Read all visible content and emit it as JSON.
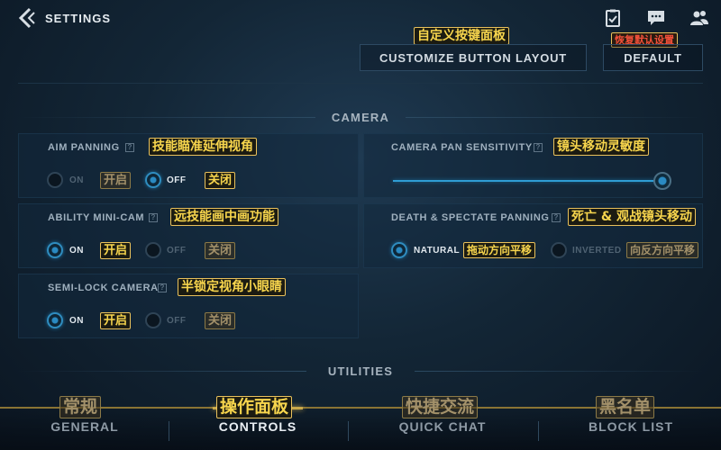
{
  "header": {
    "title": "SETTINGS",
    "icons": [
      "back-chevron-icon",
      "clipboard-check-icon",
      "chat-bubble-icon",
      "friends-icon"
    ]
  },
  "actions": {
    "customize_label": "CUSTOMIZE BUTTON LAYOUT",
    "customize_note": "自定义按键面板",
    "default_label": "DEFAULT",
    "default_note": "恢复默认设置"
  },
  "camera": {
    "section_title": "CAMERA",
    "aim_panning": {
      "label": "AIM PANNING",
      "note": "技能瞄准延伸视角",
      "on_label": "ON",
      "on_note": "开启",
      "off_label": "OFF",
      "off_note": "关闭",
      "selected": "off"
    },
    "ability_minicam": {
      "label": "ABILITY MINI-CAM",
      "note": "远技能画中画功能",
      "on_label": "ON",
      "on_note": "开启",
      "off_label": "OFF",
      "off_note": "关闭",
      "selected": "on"
    },
    "semi_lock": {
      "label": "SEMI-LOCK CAMERA",
      "note": "半锁定视角小眼睛",
      "on_label": "ON",
      "on_note": "开启",
      "off_label": "OFF",
      "off_note": "关闭",
      "selected": "on"
    },
    "pan_sensitivity": {
      "label": "CAMERA PAN SENSITIVITY",
      "note": "镜头移动灵敏度",
      "value_fraction": 1.0
    },
    "death_spectate": {
      "label": "DEATH & SPECTATE PANNING",
      "note": "死亡 & 观战镜头移动",
      "natural_label": "NATURAL",
      "natural_note": "拖动方向平移",
      "inverted_label": "INVERTED",
      "inverted_note": "向反方向平移",
      "selected": "natural"
    }
  },
  "utilities": {
    "section_title": "UTILITIES"
  },
  "tabs": [
    {
      "label": "GENERAL",
      "note": "常规",
      "active": false
    },
    {
      "label": "CONTROLS",
      "note": "操作面板",
      "active": true
    },
    {
      "label": "QUICK CHAT",
      "note": "快捷交流",
      "active": false
    },
    {
      "label": "BLOCK LIST",
      "note": "黑名单",
      "active": false
    }
  ],
  "colors": {
    "accent": "#2f8dc0",
    "tab_indicator": "#c8a84b",
    "callout_border": "#e9c15b",
    "callout_text": "#f7d54d",
    "callout_alert": "#f1503a"
  }
}
